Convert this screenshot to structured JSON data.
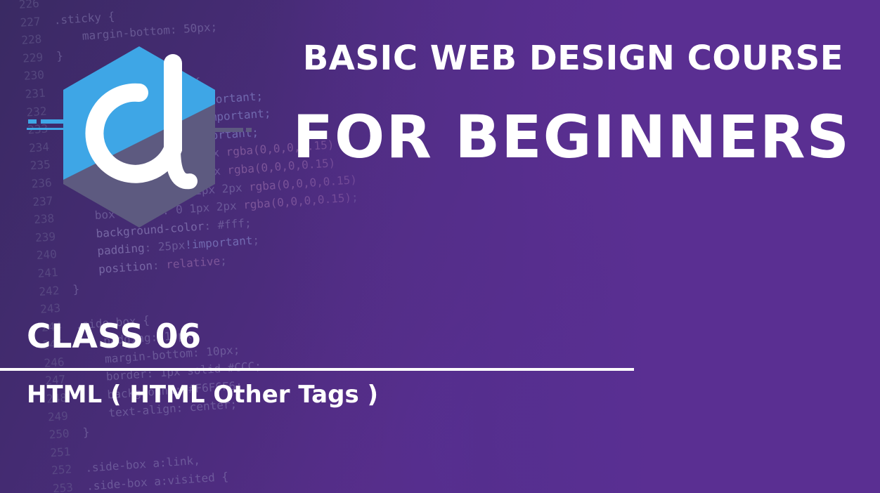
{
  "course": {
    "title_line1": "BASIC WEB DESIGN COURSE",
    "title_line2": "FOR BEGINNERS"
  },
  "lesson": {
    "class_label": "CLASS 06",
    "topic": "HTML ( HTML Other Tags )"
  },
  "logo": {
    "icon": "hexagon-d-logo-icon",
    "colors": {
      "top": "#3ea6e6",
      "bottom": "#5d5a80",
      "letter": "#ffffff"
    }
  },
  "colors": {
    "background": "#55308c",
    "text": "#ffffff"
  }
}
